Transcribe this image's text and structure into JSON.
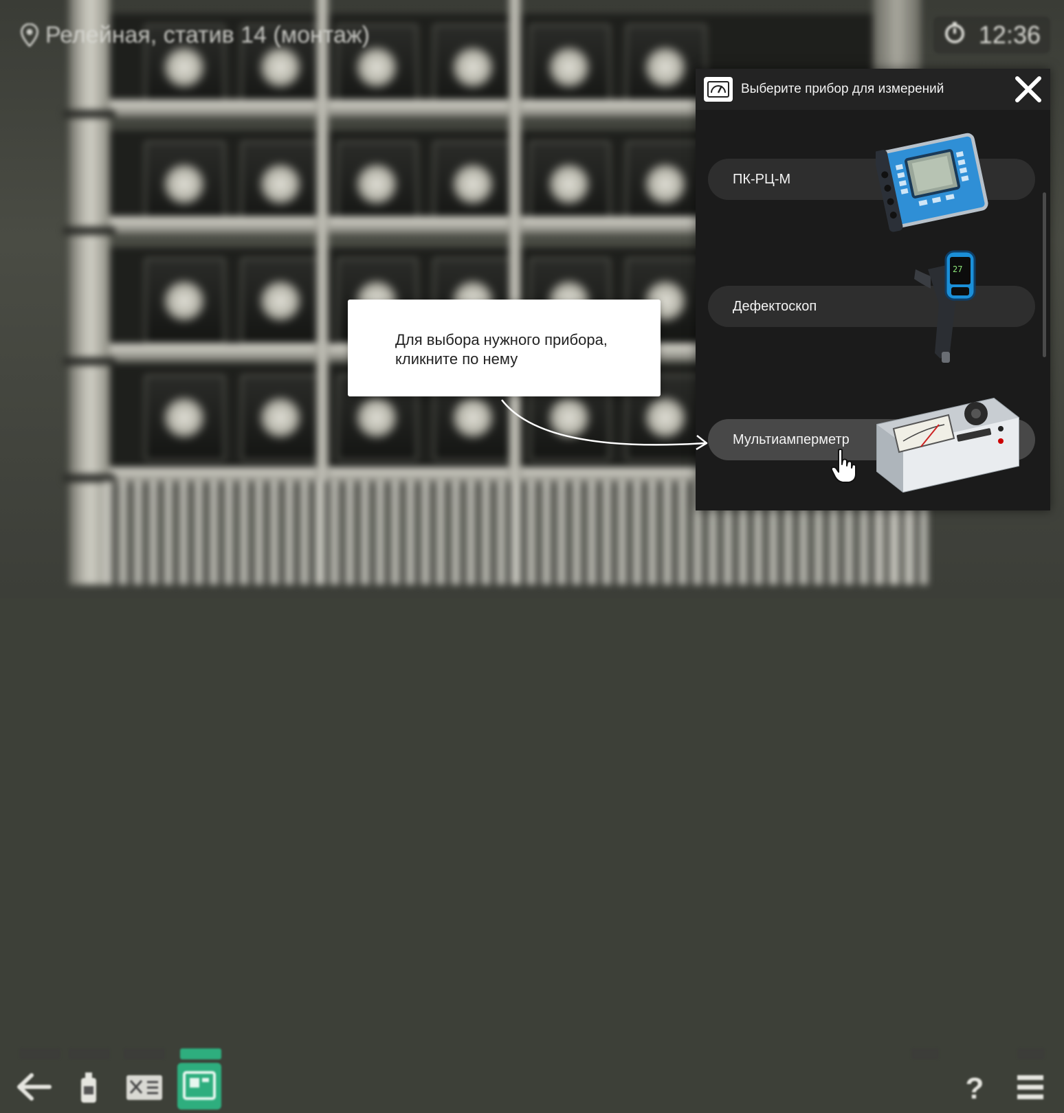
{
  "location": {
    "label": "Релейная, статив 14 (монтаж)",
    "icon": "location-pin-icon"
  },
  "timer": {
    "icon": "timer-icon",
    "time": "12:36"
  },
  "panel": {
    "icon": "gauge-icon",
    "title": "Выберите прибор для измерений",
    "close_icon": "close-icon",
    "items": [
      {
        "label": "ПК-РЦ-М",
        "image": "pk-rc-m-device-image"
      },
      {
        "label": "Дефектоскоп",
        "image": "flaw-detector-image"
      },
      {
        "label": "Мультиамперметр",
        "image": "multiammeter-image",
        "active": true
      }
    ]
  },
  "tooltip": {
    "text": "Для выбора нужного прибора, кликните по нему"
  },
  "toolbar": {
    "left": [
      "back-arrow-icon",
      "bottle-icon",
      "panel-icon",
      "device-icon"
    ],
    "right": [
      "help-icon",
      "menu-icon"
    ],
    "help_label": "?",
    "colors": {
      "active_tool": "#2eae7e"
    }
  },
  "colors": {
    "panel_bg": "#1b1b1b",
    "item_bg": "#2e2e2e",
    "item_active_bg": "#484848",
    "tooltip_bg": "#ffffff"
  }
}
